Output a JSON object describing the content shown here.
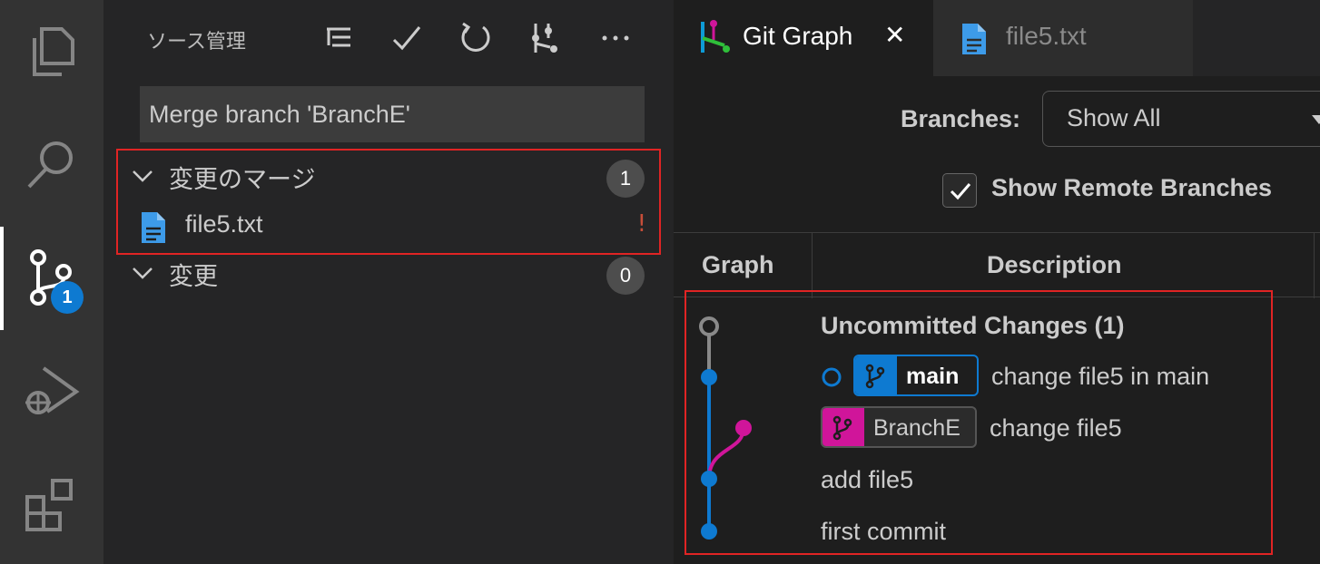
{
  "sidebar": {
    "title": "ソース管理",
    "commit_message": "Merge branch 'BranchE'",
    "merge_group": {
      "label": "変更のマージ",
      "count": "1"
    },
    "merge_file": {
      "name": "file5.txt",
      "status": "!"
    },
    "changes_group": {
      "label": "変更",
      "count": "0"
    }
  },
  "activity_bar": {
    "scm_badge": "1"
  },
  "tabs": [
    {
      "label": "Git Graph",
      "close": "✕"
    },
    {
      "label": "file5.txt"
    }
  ],
  "git_graph": {
    "branches_label": "Branches:",
    "branches_value": "Show All",
    "show_remote_label": "Show Remote Branches",
    "columns": {
      "graph": "Graph",
      "description": "Description"
    },
    "rows": [
      {
        "text": "Uncommitted Changes (1)"
      },
      {
        "ref": "main",
        "text": "change file5 in main"
      },
      {
        "ref": "BranchE",
        "text": "change file5"
      },
      {
        "text": "add file5"
      },
      {
        "text": "first commit"
      }
    ]
  },
  "colors": {
    "accent_blue": "#0e7ad1",
    "branch_magenta": "#d0159a",
    "highlight_red": "#e02424"
  }
}
